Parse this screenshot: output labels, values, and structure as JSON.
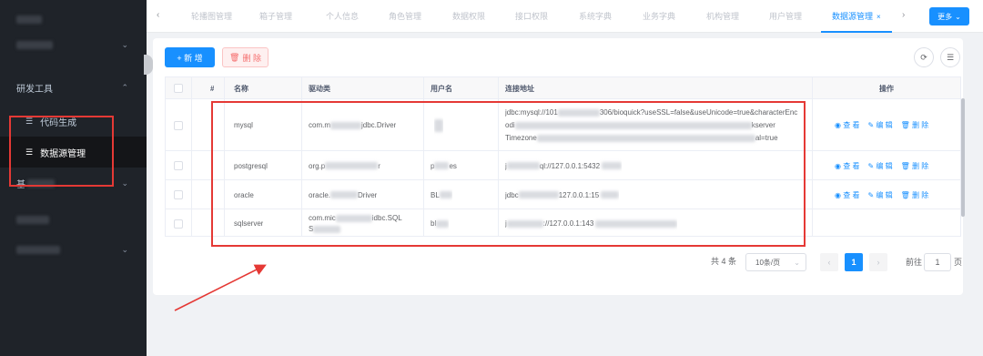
{
  "sidebar": {
    "section_label": "研发工具",
    "items": [
      {
        "label": "代码生成",
        "icon": "list-icon"
      },
      {
        "label": "数据源管理",
        "icon": "list-icon"
      }
    ],
    "partial_label": "基"
  },
  "tabs": {
    "items": [
      "轮播图管理",
      "箱子管理",
      "个人信息",
      "角色管理",
      "数据权限",
      "接口权限",
      "系统字典",
      "业务字典",
      "机构管理",
      "用户管理"
    ],
    "active": "数据源管理",
    "close_glyph": "×",
    "prev_glyph": "‹",
    "next_glyph": "›",
    "more_label": "更多",
    "more_caret": "⌄"
  },
  "toolbar": {
    "add_label": "+ 新 增",
    "delete_label": "删 除",
    "delete_icon_glyph": "🗑",
    "refresh_glyph": "⟳",
    "filter_glyph": "☰"
  },
  "table": {
    "headers": {
      "index": "#",
      "name": "名称",
      "driver": "驱动类",
      "username": "用户名",
      "url": "连接地址",
      "actions": "操作"
    },
    "rows": [
      {
        "name": "mysql",
        "driver_visible": "com.m",
        "driver_tail": "jdbc.Driver",
        "url_lines": [
          "jdbc:mysql://101",
          "306/bioquick?useSSL=false&useUnicode=true&characterEnc",
          "odi",
          "kserver",
          "Timezone",
          "al=true"
        ]
      },
      {
        "name": "postgresql",
        "driver_visible": "org.p",
        "driver_tail": "r",
        "username_visible": "p",
        "username_tail": "es",
        "url_visible": "j",
        "url_tail": "ql://127.0.0.1:5432"
      },
      {
        "name": "oracle",
        "driver_visible": "oracle.",
        "driver_tail": "Driver",
        "username_visible": "BL",
        "url_visible": "jdbc",
        "url_tail": "127.0.0.1:15"
      },
      {
        "name": "sqlserver",
        "driver_visible": "com.mic",
        "driver_tail": "idbc.SQL",
        "driver_line2": "S",
        "username_visible": "bl",
        "url_visible": "j",
        "url_tail": "://127.0.0.1:143"
      }
    ],
    "action_labels": {
      "view": "查 看",
      "edit": "编 辑",
      "delete": "删 除"
    },
    "action_glyphs": {
      "view": "◉",
      "edit": "✎",
      "delete": "🗑"
    }
  },
  "pagination": {
    "total": "共 4 条",
    "page_size": "10条/页",
    "page_size_caret": "⌄",
    "prev_glyph": "‹",
    "next_glyph": "›",
    "current_page": "1",
    "goto_prefix": "前往",
    "goto_value": "1",
    "goto_suffix": "页"
  },
  "sidebar_chevrons": {
    "up": "⌃",
    "down": "⌄"
  },
  "colors": {
    "primary": "#1890ff",
    "danger": "#f56c6c",
    "sidebar_bg": "#1f2329",
    "annotation_red": "#e53935"
  }
}
